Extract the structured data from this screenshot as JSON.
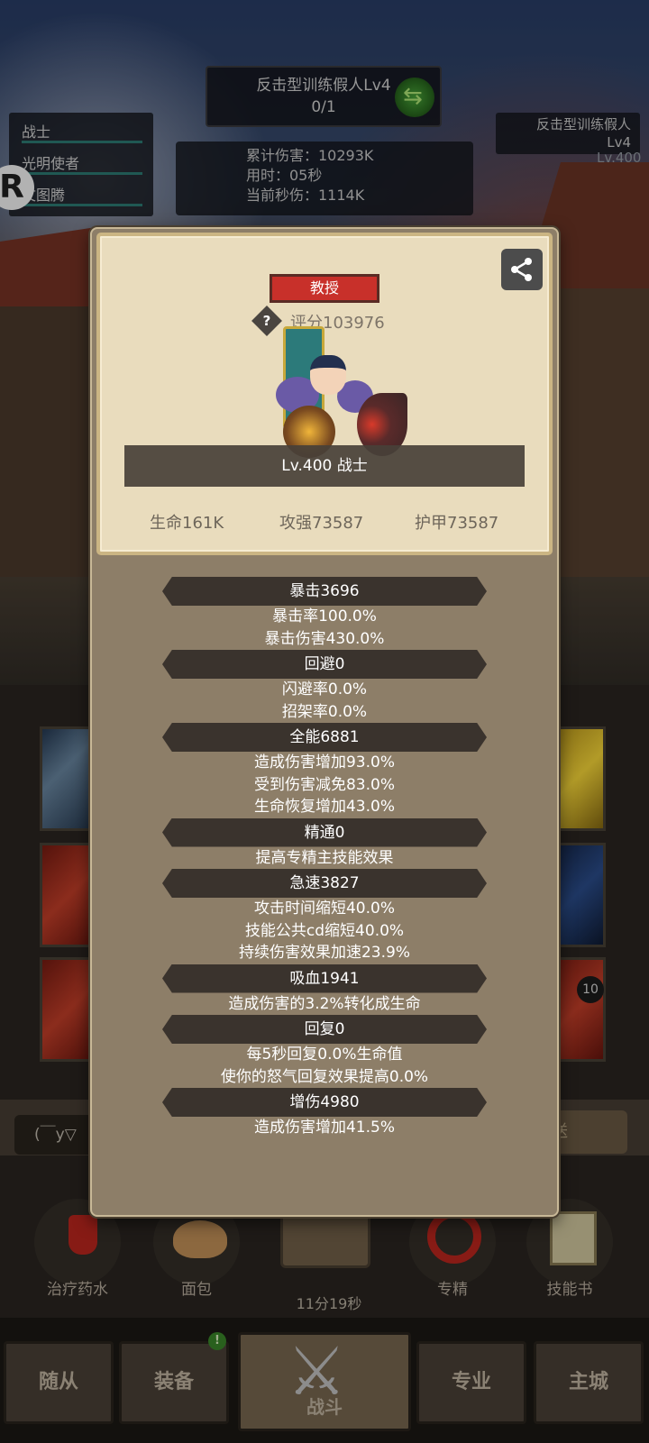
{
  "battle": {
    "target_name": "反击型训练假人Lv4",
    "target_progress": "0/1",
    "damage_total": "累计伤害：10293K",
    "time_used": "用时：05秒",
    "dps": "当前秒伤：1114K",
    "enemy_name_line1": "反击型训练假人",
    "enemy_name_line2": "Lv4",
    "enemy_level": "Lv.400"
  },
  "team": {
    "members": [
      "战士",
      "光明使者",
      "文图腾"
    ],
    "logo_letter": "R"
  },
  "panel": {
    "title_badge": "教授",
    "help_label": "?",
    "score": "评分103976",
    "level_class": "Lv.400 战士",
    "hp": "生命161K",
    "attack": "攻强73587",
    "armor": "护甲73587",
    "groups": [
      {
        "header": "暴击3696",
        "lines": [
          "暴击率100.0%",
          "暴击伤害430.0%"
        ]
      },
      {
        "header": "回避0",
        "lines": [
          "闪避率0.0%",
          "招架率0.0%"
        ]
      },
      {
        "header": "全能6881",
        "lines": [
          "造成伤害增加93.0%",
          "受到伤害减免83.0%",
          "生命恢复增加43.0%"
        ]
      },
      {
        "header": "精通0",
        "lines": [
          "提高专精主技能效果"
        ]
      },
      {
        "header": "急速3827",
        "lines": [
          "攻击时间缩短40.0%",
          "技能公共cd缩短40.0%",
          "持续伤害效果加速23.9%"
        ]
      },
      {
        "header": "吸血1941",
        "lines": [
          "造成伤害的3.2%转化成生命"
        ]
      },
      {
        "header": "回复0",
        "lines": [
          "每5秒回复0.0%生命值",
          "使你的怒气回复效果提高0.0%"
        ]
      },
      {
        "header": "增伤4980",
        "lines": [
          "造成伤害增加41.5%"
        ]
      }
    ]
  },
  "chat": {
    "input_text": "(￣y▽",
    "send_label": "送"
  },
  "skill_badge": "10",
  "items": [
    {
      "label": "治疗药水"
    },
    {
      "label": "面包"
    },
    {
      "label": ""
    },
    {
      "label": "专精"
    },
    {
      "label": "技能书"
    }
  ],
  "chest_timer": "11分19秒",
  "tabs": [
    "随从",
    "装备",
    "战斗",
    "专业",
    "主城"
  ],
  "equip_notify": "!",
  "colors": {
    "badge_red": "#c8302a",
    "card_bg": "#e9dcbd",
    "panel_bg": "#8d7e68",
    "header_dark": "#3a332d"
  }
}
